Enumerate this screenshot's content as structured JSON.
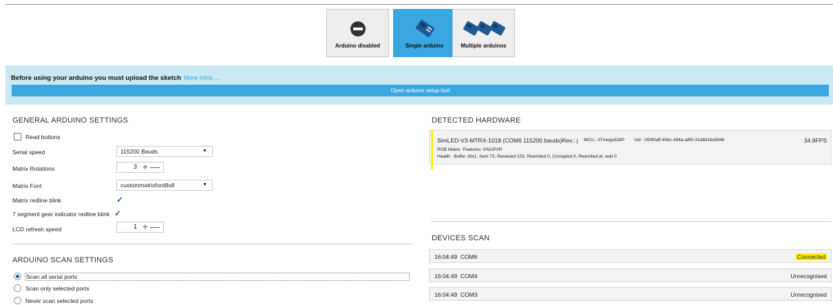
{
  "modes": [
    {
      "label": "Arduino disabled",
      "icon": "no-entry-icon",
      "selected": false
    },
    {
      "label": "Single arduino",
      "icon": "arduino-board-icon",
      "selected": true
    },
    {
      "label": "Multiple arduinos",
      "icon": "arduino-boards-icon",
      "selected": false
    }
  ],
  "banner": {
    "text": "Before using your arduino you must upload the sketch",
    "more_link": "More infos ...",
    "setup_button": "Open arduino setup tool"
  },
  "general": {
    "title": "GENERAL ARDUINO SETTINGS",
    "read_buttons": "Read buttons",
    "serial_speed_label": "Serial speed",
    "serial_speed_value": "115200 Bauds",
    "matrix_rotations_label": "Matrix Rotations",
    "matrix_rotations_value": "3",
    "matrix_font_label": "Matrix Font",
    "matrix_font_value": "custommatrixfont8x8",
    "matrix_redline_label": "Matrix redline blink",
    "gear_redline_label": "7 segment gear indicator redline blink",
    "lcd_refresh_label": "LCD refresh speed",
    "lcd_refresh_value": "1"
  },
  "scan_settings": {
    "title": "ARDUINO SCAN SETTINGS",
    "options": [
      "Scan all serial ports",
      "Scan only selected ports",
      "Never scan selected ports"
    ]
  },
  "hardware": {
    "title": "DETECTED HARDWARE",
    "name": "SimLED-V3-MTRX-1018 (COM6 115200 bauds)",
    "rev": "Rev.: j",
    "mcu": "MCU.: ATmega328P",
    "uid": "Uid : 093f0aff-60bc-494a-a8f0-31d8d18c894b",
    "fps": "34.9FPS",
    "features": "RGB Matrix  Features: GNIJPXR",
    "health": "Health:  Buffer 16x1, Sent 73, Received 103, Reemited 0, Corrupted 0, Reemited af. wait 0"
  },
  "devices": {
    "title": "DEVICES SCAN",
    "items": [
      {
        "time": "16:04:49",
        "port": "COM6",
        "status": "Connected"
      },
      {
        "time": "16:04:49",
        "port": "COM4",
        "status": "Unrecognised"
      },
      {
        "time": "16:04:49",
        "port": "COM3",
        "status": "Unrecognised"
      }
    ]
  },
  "colors": {
    "accent": "#3aa7e0",
    "banner": "#c9e9f3",
    "highlight": "#ffee00"
  }
}
